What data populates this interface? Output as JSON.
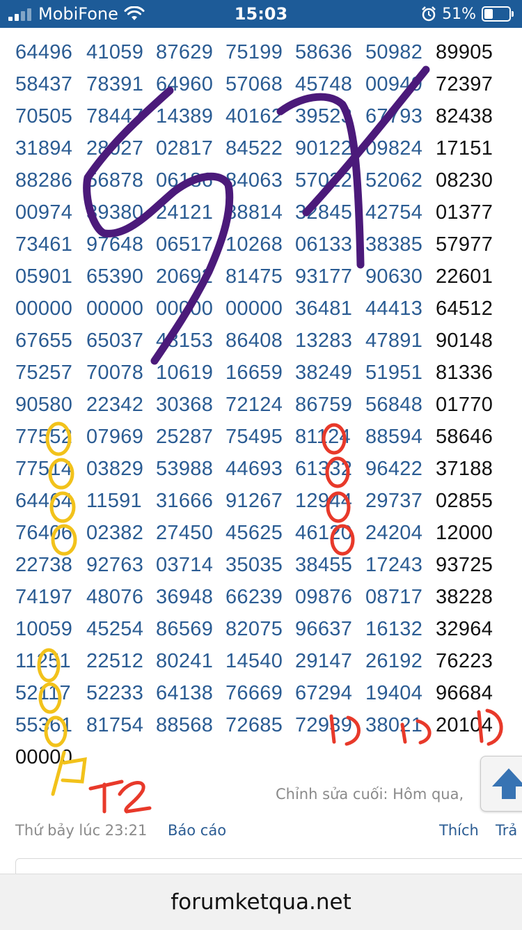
{
  "status_bar": {
    "carrier": "MobiFone",
    "time": "15:03",
    "battery": "51%",
    "icons": [
      "signal-icon",
      "wifi-icon",
      "alarm-icon",
      "battery-icon"
    ]
  },
  "number_rows": [
    [
      "64496",
      "41059",
      "87629",
      "75199",
      "58636",
      "50982",
      "89905"
    ],
    [
      "58437",
      "78391",
      "64960",
      "57068",
      "45748",
      "00949",
      "72397"
    ],
    [
      "70505",
      "78447",
      "14389",
      "40162",
      "39523",
      "67793",
      "82438"
    ],
    [
      "31894",
      "28027",
      "02817",
      "84522",
      "90122",
      "09824",
      "17151"
    ],
    [
      "88286",
      "56878",
      "06186",
      "84063",
      "57022",
      "52062",
      "08230"
    ],
    [
      "00974",
      "39380",
      "24121",
      "88814",
      "32845",
      "42754",
      "01377"
    ],
    [
      "73461",
      "97648",
      "06517",
      "10268",
      "06133",
      "38385",
      "57977"
    ],
    [
      "05901",
      "65390",
      "20692",
      "81475",
      "93177",
      "90630",
      "22601"
    ],
    [
      "00000",
      "00000",
      "00000",
      "00000",
      "36481",
      "44413",
      "64512"
    ],
    [
      "67655",
      "65037",
      "48153",
      "86408",
      "13283",
      "47891",
      "90148"
    ],
    [
      "75257",
      "70078",
      "10619",
      "16659",
      "38249",
      "51951",
      "81336"
    ],
    [
      "90580",
      "22342",
      "30368",
      "72124",
      "86759",
      "56848",
      "01770"
    ],
    [
      "77552",
      "07969",
      "25287",
      "75495",
      "81124",
      "88594",
      "58646"
    ],
    [
      "77514",
      "03829",
      "53988",
      "44693",
      "61332",
      "96422",
      "37188"
    ],
    [
      "64464",
      "11591",
      "31666",
      "91267",
      "12944",
      "29737",
      "02855"
    ],
    [
      "76406",
      "02382",
      "27450",
      "45625",
      "46120",
      "24204",
      "12000"
    ],
    [
      "22738",
      "92763",
      "03714",
      "35035",
      "38455",
      "17243",
      "93725"
    ],
    [
      "74197",
      "48076",
      "36948",
      "66239",
      "09876",
      "08717",
      "38228"
    ],
    [
      "10059",
      "45254",
      "86569",
      "82075",
      "96637",
      "16132",
      "32964"
    ],
    [
      "11251",
      "22512",
      "80241",
      "14540",
      "29147",
      "26192",
      "76223"
    ],
    [
      "52117",
      "52233",
      "64138",
      "76669",
      "67294",
      "19404",
      "96684"
    ],
    [
      "55361",
      "81754",
      "88568",
      "72685",
      "72939",
      "38021",
      "20104"
    ],
    [
      "00000"
    ]
  ],
  "post": {
    "edited_note": "Chỉnh sửa cuối: Hôm qua,",
    "timestamp": "Thứ bảy lúc 23:21",
    "report_label": "Báo cáo",
    "like_label": "Thích",
    "reply_label": "Trả"
  },
  "browser": {
    "url": "forumketqua.net"
  },
  "handwriting": {
    "annotation_1": "5x",
    "annotation_2": "T2",
    "colors": {
      "purple": "#4b1a7a",
      "yellow": "#f2c21b",
      "red": "#e8392a"
    }
  },
  "colors": {
    "status_bar_bg": "#1d5b98",
    "link_blue": "#2b5c93",
    "number_black": "#111111"
  }
}
